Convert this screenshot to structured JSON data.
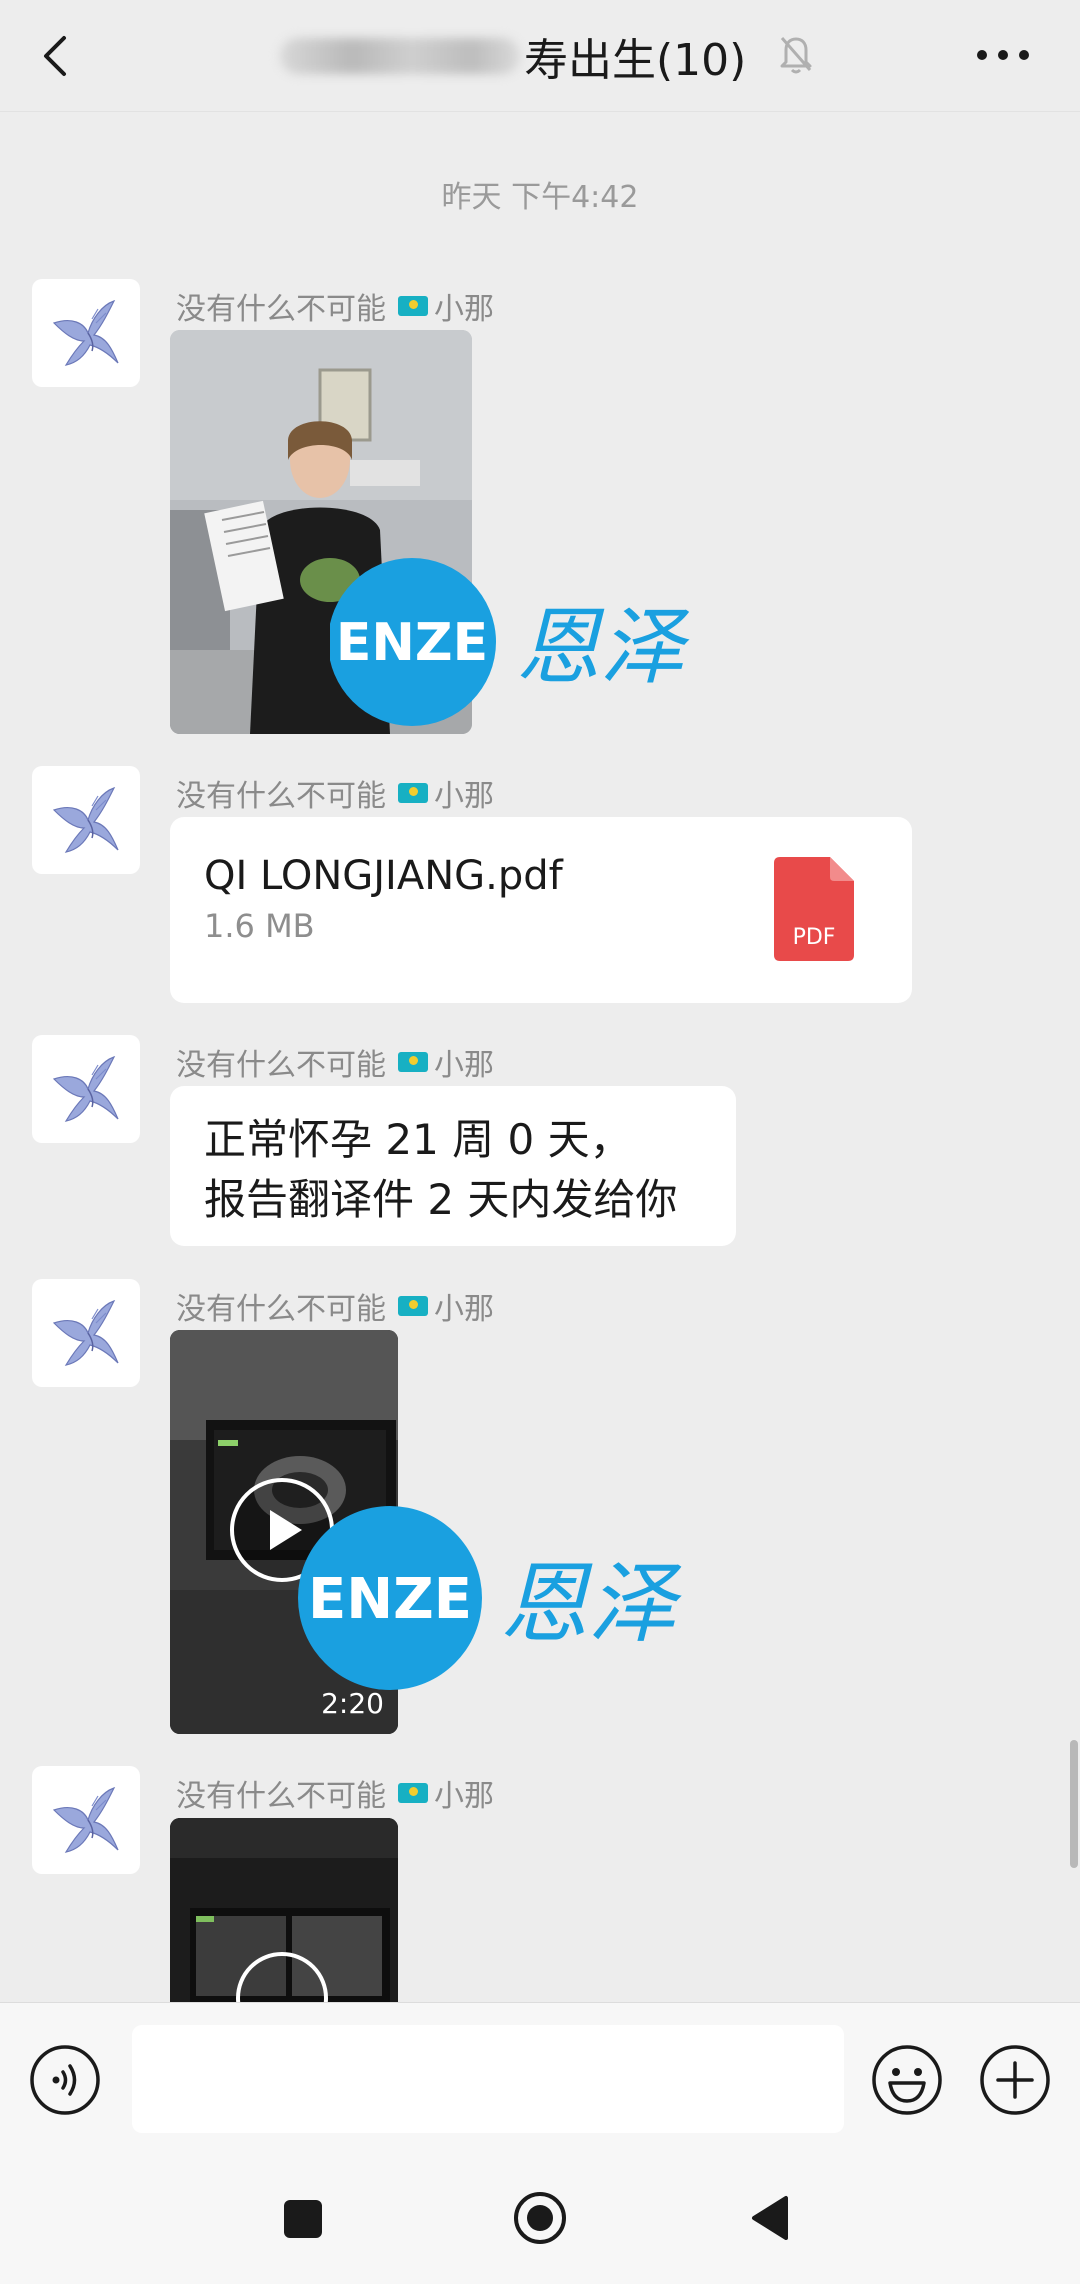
{
  "header": {
    "title_visible": "寿出生(10)",
    "title_icons": {
      "back": "chevron-left-icon",
      "mute": "bell-off-icon",
      "more": "more-dots-icon"
    }
  },
  "chat": {
    "timestamp": "昨天 下午4:42",
    "messages": [
      {
        "type": "image",
        "sender": "没有什么不可能",
        "sender_suffix": "小那",
        "flag": "kazakhstan-flag"
      },
      {
        "type": "file",
        "sender": "没有什么不可能",
        "sender_suffix": "小那",
        "file_name": "QI LONGJIANG.pdf",
        "file_size": "1.6 MB",
        "file_badge": "PDF"
      },
      {
        "type": "text",
        "sender": "没有什么不可能",
        "sender_suffix": "小那",
        "lines": [
          "正常怀孕 21 周 0 天，",
          "报告翻译件 2 天内发给你"
        ]
      },
      {
        "type": "video",
        "sender": "没有什么不可能",
        "sender_suffix": "小那",
        "duration": "2:20"
      },
      {
        "type": "video",
        "sender": "没有什么不可能",
        "sender_suffix": "小那"
      }
    ]
  },
  "watermark": {
    "logo_text": "ENZE",
    "cn_text": "恩泽",
    "color": "#1aa0e0"
  },
  "input_bar": {
    "placeholder": "",
    "value": ""
  },
  "colors": {
    "background": "#ededed",
    "bubble": "#ffffff",
    "pdf_red": "#e84a4a",
    "brand_blue": "#1aa0e0"
  }
}
